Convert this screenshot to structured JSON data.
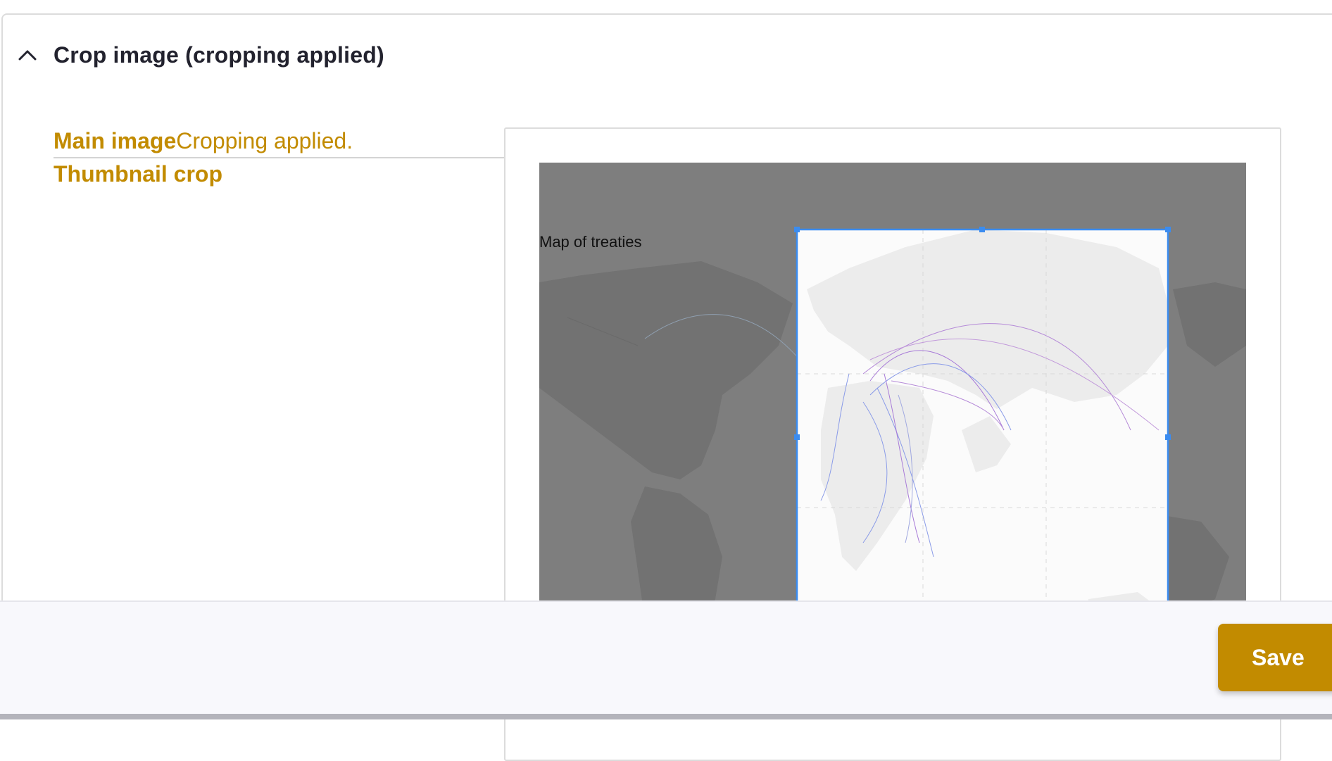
{
  "section": {
    "title": "Crop image (cropping applied)"
  },
  "tabs": {
    "main_label": "Main image",
    "main_status": "Cropping applied.",
    "thumbnail_label": "Thumbnail crop"
  },
  "image": {
    "caption": "Map of treaties"
  },
  "footer": {
    "save_label": "Save"
  },
  "colors": {
    "accent": "#c28b00",
    "crop_border": "#3b8cf0",
    "title_text": "#22222e"
  }
}
